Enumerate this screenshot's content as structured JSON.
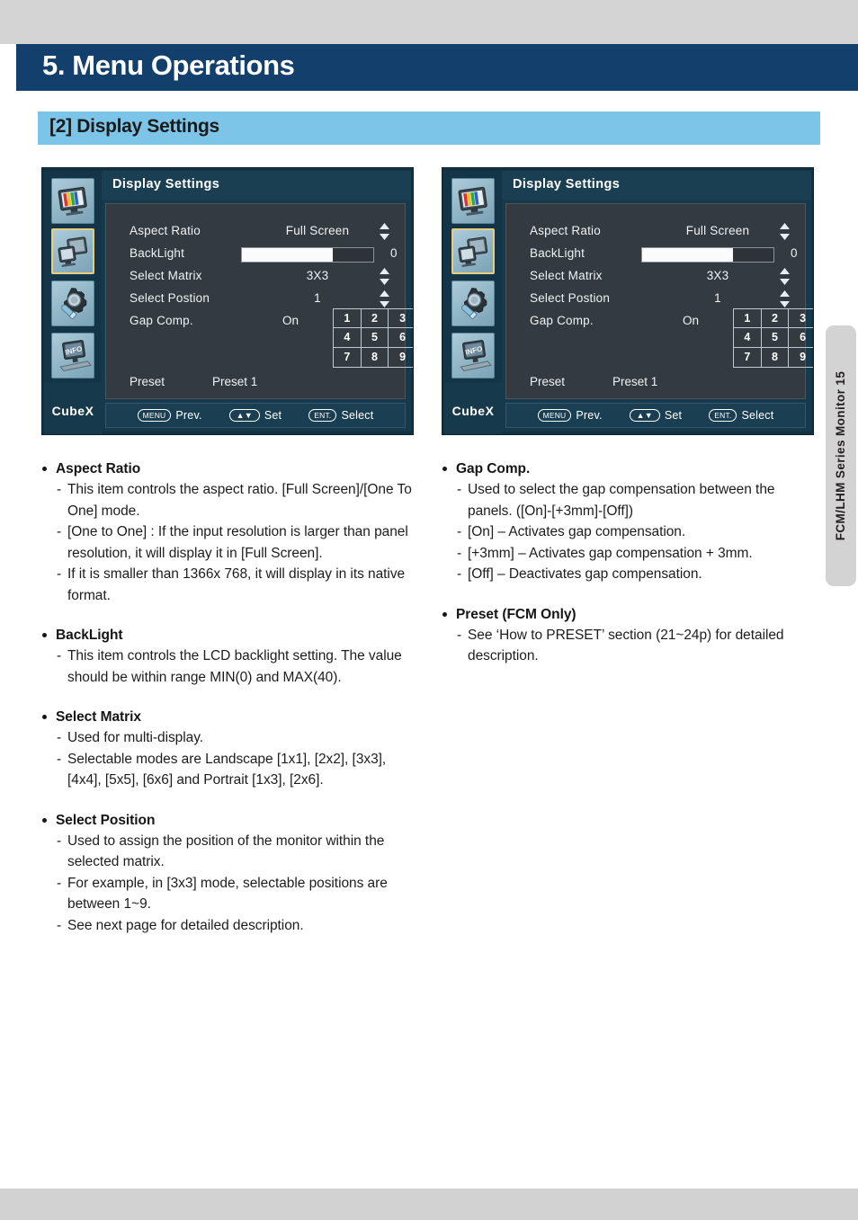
{
  "page": {
    "chapter_title": "5. Menu Operations",
    "section_title": "[2] Display Settings",
    "side_tab_label": "FCM/LHM Series Monitor  15",
    "colors": {
      "chapter_bar": "#123f6c",
      "section_bar": "#7dc5e8",
      "page_band": "#d4d4d4",
      "osd_frame": "#123241",
      "osd_header": "#1b3f52",
      "osd_body": "#333b41",
      "osd_selected_icon_border": "#e8cd7f"
    }
  },
  "osd": {
    "title": "Display Settings",
    "brand": "CubeX",
    "icons": [
      {
        "name": "picture-settings-icon",
        "selected": false
      },
      {
        "name": "display-settings-icon",
        "selected": true
      },
      {
        "name": "tool-settings-icon",
        "selected": false
      },
      {
        "name": "information-icon",
        "selected": false
      }
    ],
    "rows": {
      "aspect_ratio": {
        "label": "Aspect Ratio",
        "value": "Full Screen"
      },
      "backlight": {
        "label": "BackLight",
        "value": "0",
        "fill_percent": 69
      },
      "select_matrix": {
        "label": "Select Matrix",
        "value": "3X3"
      },
      "select_position": {
        "label": "Select Postion",
        "value": "1"
      },
      "gap_comp": {
        "label": "Gap Comp.",
        "value": "On"
      },
      "preset": {
        "label": "Preset",
        "value": "Preset 1"
      }
    },
    "position_grid": [
      "1",
      "2",
      "3",
      "4",
      "5",
      "6",
      "7",
      "8",
      "9"
    ],
    "footer": [
      {
        "key": "MENU",
        "action": "Prev."
      },
      {
        "key": "▲▼",
        "action": "Set"
      },
      {
        "key": "ENT.",
        "action": "Select"
      }
    ]
  },
  "content": {
    "left": [
      {
        "heading": "Aspect Ratio",
        "items": [
          "This item controls the aspect ratio. [Full Screen]/[One To One] mode.",
          "[One to One] : If the input resolution is larger than panel resolution, it will display it in [Full Screen].",
          "If it is smaller than 1366x 768, it will display in its native format."
        ]
      },
      {
        "heading": "BackLight",
        "items": [
          "This item controls the LCD backlight setting. The value should be within range MIN(0) and MAX(40)."
        ]
      },
      {
        "heading": "Select Matrix",
        "items": [
          "Used for multi-display.",
          "Selectable modes are Landscape [1x1], [2x2], [3x3], [4x4], [5x5], [6x6] and Portrait [1x3], [2x6]."
        ]
      },
      {
        "heading": "Select Position",
        "items": [
          "Used to assign the position of the monitor within the selected matrix.",
          "For example, in [3x3] mode, selectable positions are between 1~9.",
          "See next page for detailed description."
        ]
      }
    ],
    "right": [
      {
        "heading": "Gap Comp.",
        "items": [
          "Used to select the gap compensation between the panels. ([On]-[+3mm]-[Off])",
          "[On] – Activates gap compensation.",
          "[+3mm] – Activates gap compensation + 3mm.",
          "[Off] – Deactivates gap compensation."
        ]
      },
      {
        "heading": "Preset (FCM Only)",
        "items": [
          "See ‘How to PRESET’ section (21~24p) for detailed description."
        ]
      }
    ]
  }
}
